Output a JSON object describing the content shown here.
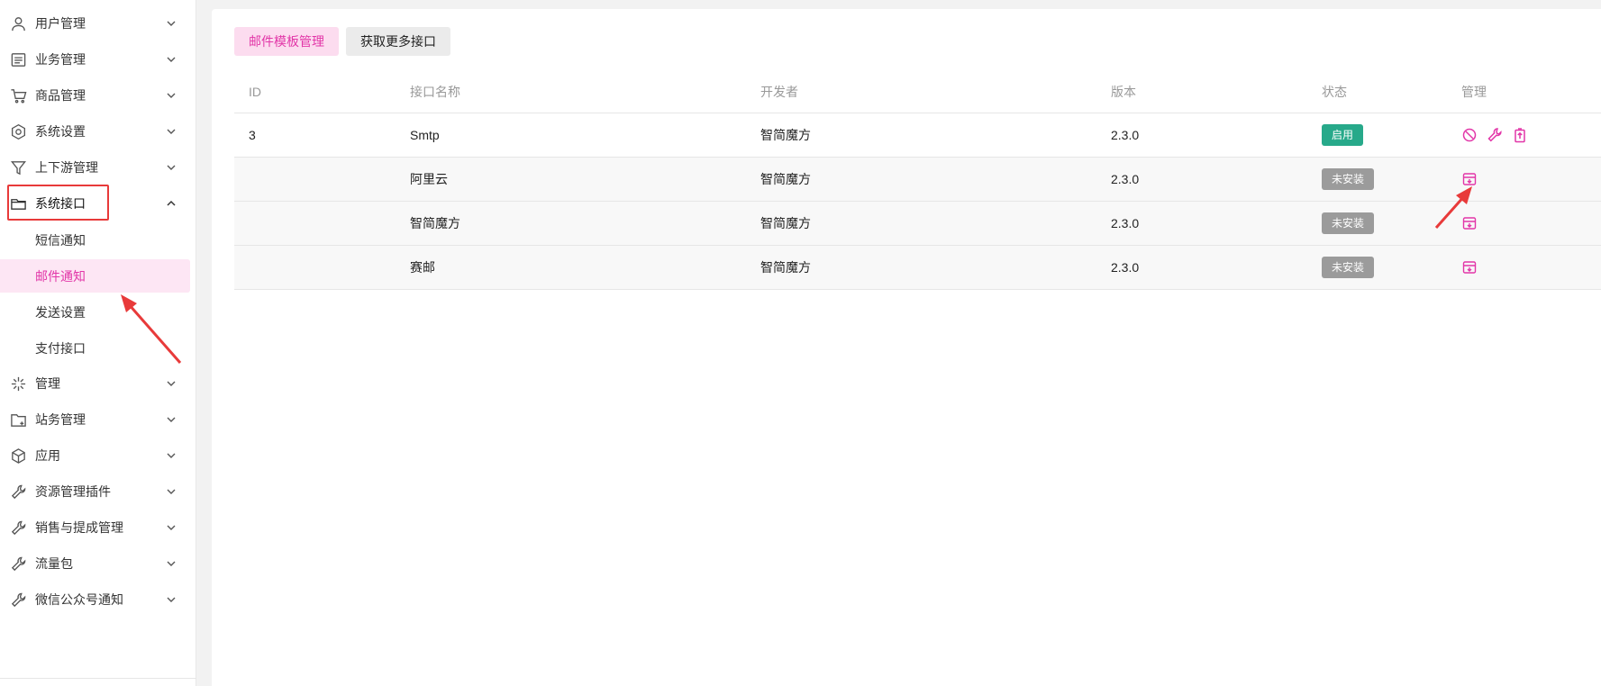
{
  "sidebar": {
    "items": [
      {
        "label": "用户管理",
        "icon": "user-icon"
      },
      {
        "label": "业务管理",
        "icon": "list-icon"
      },
      {
        "label": "商品管理",
        "icon": "cart-icon"
      },
      {
        "label": "系统设置",
        "icon": "hexagon-settings-icon"
      },
      {
        "label": "上下游管理",
        "icon": "funnel-icon"
      },
      {
        "label": "系统接口",
        "icon": "folder-icon",
        "expanded": true
      },
      {
        "label": "管理",
        "icon": "sparkle-icon"
      },
      {
        "label": "站务管理",
        "icon": "folder-add-icon"
      },
      {
        "label": "应用",
        "icon": "cube-icon"
      },
      {
        "label": "资源管理插件",
        "icon": "wrench-icon"
      },
      {
        "label": "销售与提成管理",
        "icon": "wrench-icon"
      },
      {
        "label": "流量包",
        "icon": "wrench-icon"
      },
      {
        "label": "微信公众号通知",
        "icon": "wrench-icon"
      }
    ],
    "sub_items": [
      {
        "label": "短信通知",
        "active": false
      },
      {
        "label": "邮件通知",
        "active": true
      },
      {
        "label": "发送设置",
        "active": false
      },
      {
        "label": "支付接口",
        "active": false
      }
    ]
  },
  "toolbar": {
    "template_btn": "邮件模板管理",
    "more_btn": "获取更多接口"
  },
  "table": {
    "headers": [
      "ID",
      "接口名称",
      "开发者",
      "版本",
      "状态",
      "管理"
    ],
    "rows": [
      {
        "id": "3",
        "name": "Smtp",
        "developer": "智简魔方",
        "version": "2.3.0",
        "status": "启用",
        "installed": true
      },
      {
        "id": "",
        "name": "阿里云",
        "developer": "智简魔方",
        "version": "2.3.0",
        "status": "未安装",
        "installed": false
      },
      {
        "id": "",
        "name": "智简魔方",
        "developer": "智简魔方",
        "version": "2.3.0",
        "status": "未安装",
        "installed": false
      },
      {
        "id": "",
        "name": "赛邮",
        "developer": "智简魔方",
        "version": "2.3.0",
        "status": "未安装",
        "installed": false
      }
    ]
  },
  "colors": {
    "accent": "#e236a8",
    "enabled": "#27a98a",
    "not_installed": "#9b9b9b",
    "annotation": "#e83a3a"
  }
}
